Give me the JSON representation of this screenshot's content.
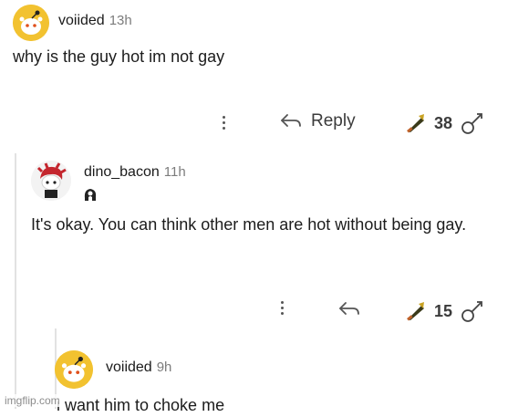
{
  "comments": [
    {
      "username": "voiided",
      "time": "13h",
      "text": "why is the guy hot im not gay",
      "actions": {
        "reply_label": "Reply",
        "score": "38"
      },
      "avatar_icon": "snoo-yellow-avatar-icon"
    },
    {
      "username": "dino_bacon",
      "time": "11h",
      "text": "It's okay. You can think other men are hot without being gay.",
      "actions": {
        "reply_label": "",
        "score": "15"
      },
      "avatar_icon": "red-hair-snoo-avatar-icon"
    },
    {
      "username": "voiided",
      "time": "9h",
      "text": "i want him to choke me",
      "avatar_icon": "snoo-yellow-avatar-icon"
    }
  ],
  "watermark": "imgflip.com",
  "colors": {
    "avatar_yellow": "#f2c230",
    "accent_orange": "#c0622a",
    "muted_gray": "#7c7c7c"
  }
}
